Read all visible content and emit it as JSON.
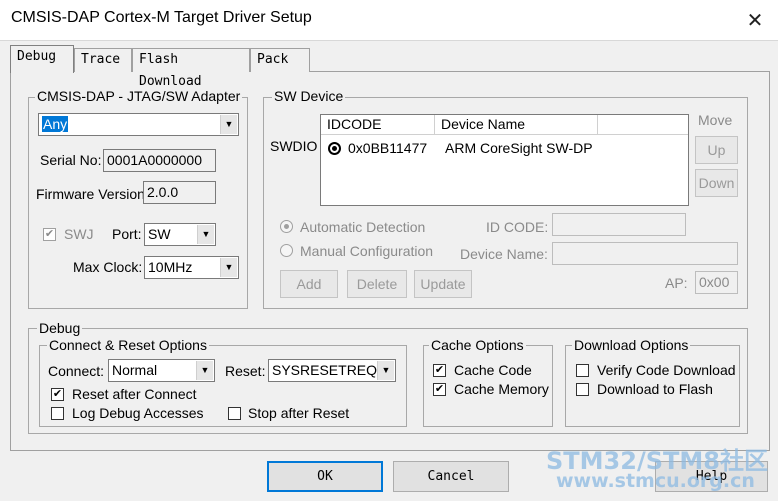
{
  "window": {
    "title": "CMSIS-DAP Cortex-M Target Driver Setup",
    "close_glyph": "✕"
  },
  "tabs": [
    {
      "label": "Debug"
    },
    {
      "label": "Trace"
    },
    {
      "label": "Flash Download"
    },
    {
      "label": "Pack"
    }
  ],
  "adapter": {
    "group_label": "CMSIS-DAP - JTAG/SW Adapter",
    "adapter_value": "Any",
    "serial_label": "Serial No:",
    "serial_value": "0001A0000000",
    "firmware_label": "Firmware Version:",
    "firmware_value": "2.0.0",
    "swj_label": "SWJ",
    "swj_check": "✔",
    "port_label": "Port:",
    "port_value": "SW",
    "maxclock_label": "Max Clock:",
    "maxclock_value": "10MHz"
  },
  "sw_device": {
    "group_label": "SW Device",
    "swdio_label": "SWDIO",
    "columns": [
      "IDCODE",
      "Device Name"
    ],
    "rows": [
      {
        "idcode": "0x0BB11477",
        "name": "ARM CoreSight SW-DP"
      }
    ],
    "move_label": "Move",
    "up_label": "Up",
    "down_label": "Down",
    "auto_label": "Automatic Detection",
    "manual_label": "Manual Configuration",
    "idcode_label": "ID CODE:",
    "devname_label": "Device Name:",
    "add_label": "Add",
    "delete_label": "Delete",
    "update_label": "Update",
    "ap_label": "AP:",
    "ap_value": "0x00"
  },
  "debug": {
    "group_label": "Debug",
    "connect_group_label": "Connect & Reset Options",
    "connect_label": "Connect:",
    "connect_value": "Normal",
    "reset_label": "Reset:",
    "reset_value": "SYSRESETREQ",
    "reset_after_label": "Reset after Connect",
    "log_label": "Log Debug Accesses",
    "stop_label": "Stop after Reset",
    "cache_group_label": "Cache Options",
    "cache_code_label": "Cache Code",
    "cache_memory_label": "Cache Memory",
    "download_group_label": "Download Options",
    "verify_label": "Verify Code Download",
    "flash_label": "Download to Flash",
    "check_mark": "✔"
  },
  "footer": {
    "ok_label": "OK",
    "cancel_label": "Cancel",
    "help_label": "Help"
  },
  "watermark": {
    "line1": "STM32/STM8社区",
    "line2": "www.stmcu.org.cn"
  },
  "icons": {
    "dropdown": "▼",
    "radio_selected": "radio-selected-icon"
  }
}
